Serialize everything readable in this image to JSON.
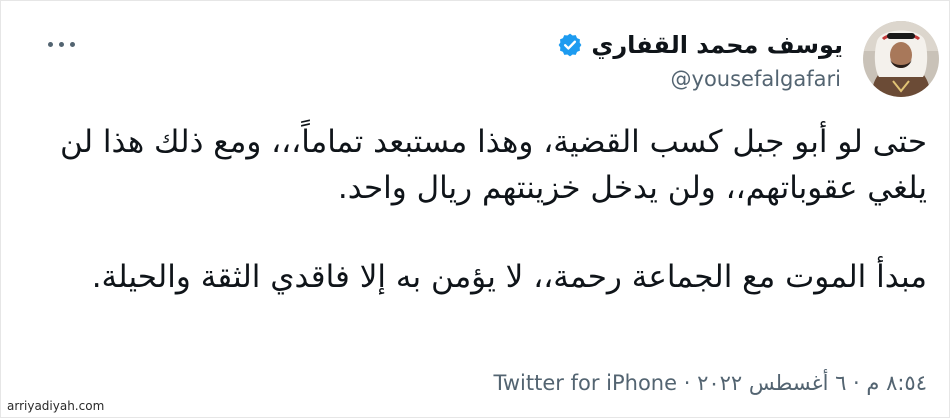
{
  "author": {
    "name": "يوسف محمد القفاري",
    "handle": "@yousefalgafari"
  },
  "tweet": {
    "paragraphs": [
      "حتى لو أبو جبل كسب القضية، وهذا مستبعد تماماً،،، ومع ذلك هذا لن يلغي عقوباتهم،، ولن يدخل خزينتهم ريال واحد.",
      "مبدأ الموت مع الجماعة رحمة،،  لا يؤمن به إلا فاقدي الثقة والحيلة."
    ]
  },
  "meta": {
    "timestamp": "٨:٥٤ م · ٦ أغسطس ٢٠٢٢",
    "separator": " · ",
    "source": "Twitter for iPhone"
  },
  "watermark": "arriyadiyah.com",
  "colors": {
    "text": "#0f1419",
    "secondary": "#536471",
    "verified": "#1d9bf0"
  },
  "icons": {
    "more": "more-dots-icon",
    "verified": "verified-badge-icon"
  }
}
